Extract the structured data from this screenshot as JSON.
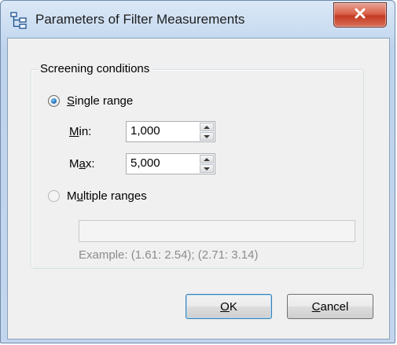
{
  "window": {
    "title": "Parameters of Filter Measurements"
  },
  "group": {
    "caption": "Screening conditions"
  },
  "single_range": {
    "label_pre": "",
    "label_mnemonic": "S",
    "label_post": "ingle range",
    "checked": true,
    "min": {
      "label_pre": "",
      "label_mnemonic": "M",
      "label_post": "in:",
      "value": "1,000"
    },
    "max": {
      "label_pre": "M",
      "label_mnemonic": "a",
      "label_post": "x:",
      "value": "5,000"
    }
  },
  "multiple_ranges": {
    "label_pre": "M",
    "label_mnemonic": "u",
    "label_post": "ltiple ranges",
    "checked": false,
    "value": "",
    "example": "Example: (1.61: 2.54); (2.71: 3.14)"
  },
  "buttons": {
    "ok": {
      "mnemonic": "O",
      "rest": "K"
    },
    "cancel": {
      "mnemonic": "C",
      "rest": "ancel"
    }
  },
  "colors": {
    "close_button": "#c43b22",
    "disabled_text": "#8c8c8c",
    "default_button_border": "#3c7fb1"
  },
  "icons": {
    "app": "tree-structure-icon",
    "close": "close-x-icon",
    "spin_up": "triangle-up-icon",
    "spin_down": "triangle-down-icon"
  }
}
